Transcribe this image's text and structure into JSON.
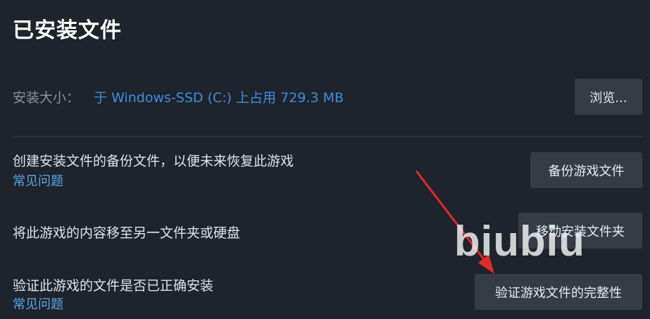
{
  "header": {
    "title": "已安装文件"
  },
  "install_size": {
    "label": "安装大小：",
    "value": "于 Windows-SSD (C:) 上占用 729.3 MB",
    "browse_button": "浏览..."
  },
  "backup": {
    "description": "创建安装文件的备份文件，以便未来恢复此游戏",
    "faq_link": "常见问题",
    "button": "备份游戏文件"
  },
  "move": {
    "description": "将此游戏的内容移至另一文件夹或硬盘",
    "button": "移动安装文件夹"
  },
  "verify": {
    "description": "验证此游戏的文件是否已正确安装",
    "faq_link": "常见问题",
    "button": "验证游戏文件的完整性"
  },
  "watermark": {
    "text": "biubiu"
  },
  "colors": {
    "background": "#1f232c",
    "button": "#363b46",
    "link": "#5aa9e6",
    "size_value": "#3d8fe0",
    "arrow": "#e02b2b"
  },
  "annotation": {
    "icon": "red-arrow-icon"
  }
}
